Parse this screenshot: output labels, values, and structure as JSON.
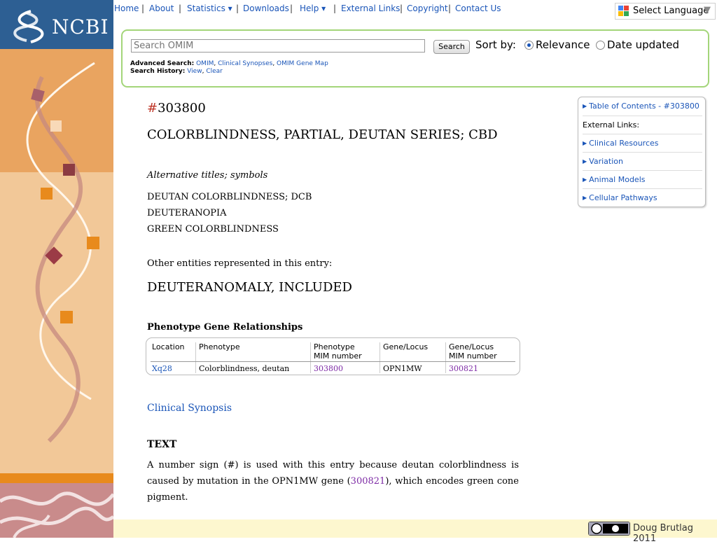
{
  "logo": {
    "text": "NCBI"
  },
  "nav": {
    "items": [
      "Home",
      "About",
      "Statistics ▾",
      "Downloads",
      "Help ▾",
      "External Links",
      "Copyright",
      "Contact Us"
    ],
    "separator": "|"
  },
  "language": {
    "label": "Select Language",
    "arrow": "▼"
  },
  "search": {
    "placeholder": "Search OMIM",
    "button_label": "Search",
    "sort_label": "Sort by:",
    "sort_options": [
      {
        "label": "Relevance",
        "selected": true
      },
      {
        "label": "Date updated",
        "selected": false
      }
    ],
    "advanced_label": "Advanced Search:",
    "advanced_links": [
      "OMIM",
      "Clinical Synopses",
      "OMIM Gene Map"
    ],
    "history_label": "Search History:",
    "history_links": [
      "View",
      "Clear"
    ]
  },
  "entry": {
    "hash": "#",
    "number": "303800",
    "title": "COLORBLINDNESS, PARTIAL, DEUTAN SERIES; CBD",
    "alt_heading": "Alternative titles; symbols",
    "alt_titles": [
      "DEUTAN COLORBLINDNESS; DCB",
      "DEUTERANOPIA",
      "GREEN COLORBLINDNESS"
    ],
    "other_heading": "Other entities represented in this entry:",
    "included": "DEUTERANOMALY, INCLUDED"
  },
  "phenotype": {
    "heading": "Phenotype Gene Relationships",
    "columns": [
      "Location",
      "Phenotype",
      "Phenotype MIM number",
      "Gene/Locus",
      "Gene/Locus MIM number"
    ],
    "columns_line1": [
      "Location",
      "Phenotype",
      "Phenotype",
      "Gene/Locus",
      "Gene/Locus"
    ],
    "columns_line2": [
      "",
      "",
      "MIM number",
      "",
      "MIM number"
    ],
    "rows": [
      [
        "Xq28",
        "Colorblindness, deutan",
        "303800",
        "OPN1MW",
        "300821"
      ]
    ]
  },
  "clinical_synopsis": "Clinical Synopsis",
  "text_section": {
    "heading": "TEXT",
    "part1": "A number sign (#) is used with this entry because deutan colorblindness is caused by mutation in the OPN1MW gene (",
    "link": "300821",
    "part2": "), which encodes green cone pigment."
  },
  "toc": {
    "items": [
      "Table of Contents - #303800",
      "External Links:",
      "Clinical Resources",
      "Variation",
      "Animal Models",
      "Cellular Pathways"
    ]
  },
  "footer": {
    "credit": "Doug Brutlag 2011"
  },
  "colors": {
    "link": "#1a55b8",
    "visited_link": "#7d2aa5",
    "search_border": "#a3d579",
    "logo_bg": "#2d5f93",
    "sidebar_bg": "#f2c898",
    "sidebar_dark": "#e9a460",
    "footer_bg": "#fdf7cf"
  }
}
